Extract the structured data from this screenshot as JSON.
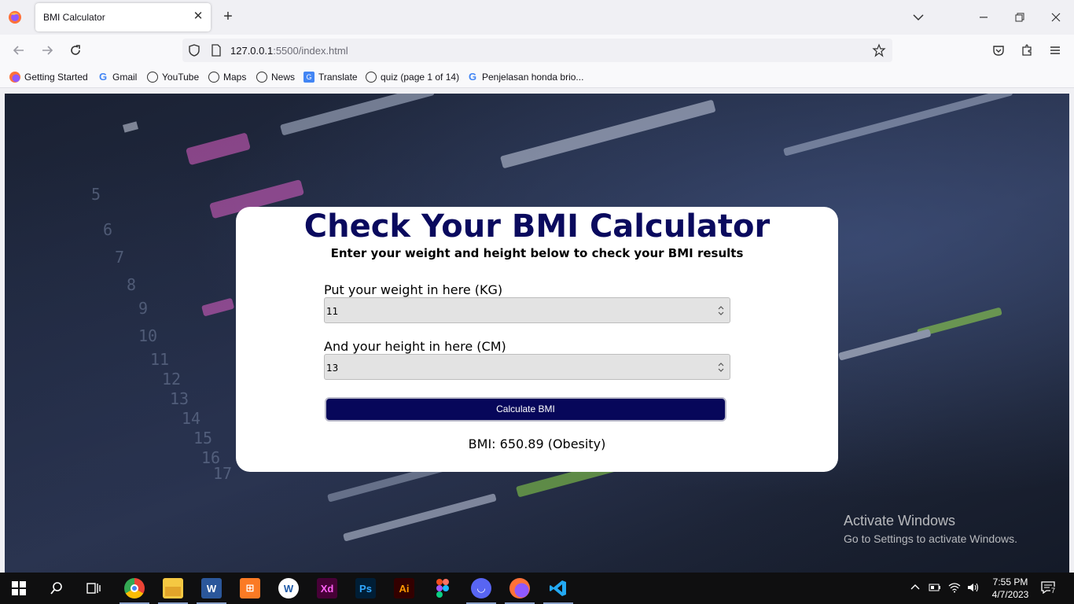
{
  "browser": {
    "tab_title": "BMI Calculator",
    "url_host": "127.0.0.1",
    "url_rest": ":5500/index.html"
  },
  "bookmarks": [
    {
      "label": "Getting Started",
      "icon": "firefox-icon"
    },
    {
      "label": "Gmail",
      "icon": "google-icon"
    },
    {
      "label": "YouTube",
      "icon": "globe-icon"
    },
    {
      "label": "Maps",
      "icon": "globe-icon"
    },
    {
      "label": "News",
      "icon": "globe-icon"
    },
    {
      "label": "Translate",
      "icon": "translate-icon"
    },
    {
      "label": "quiz (page 1 of 14)",
      "icon": "globe-icon"
    },
    {
      "label": "Penjelasan honda brio...",
      "icon": "google-icon"
    }
  ],
  "page": {
    "title": "Check Your BMI Calculator",
    "subtitle": "Enter your weight and height below to check your BMI results",
    "weight_label": "Put your weight in here (KG)",
    "weight_value": "11",
    "height_label": "And your height in here (CM)",
    "height_value": "13",
    "button_label": "Calculate BMI",
    "result": "BMI: 650.89 (Obesity)"
  },
  "watermark": {
    "line1": "Activate Windows",
    "line2": "Go to Settings to activate Windows."
  },
  "taskbar": {
    "time": "7:55 PM",
    "date": "4/7/2023",
    "notification_count": "7",
    "apps": [
      "start",
      "search",
      "task-view",
      "chrome",
      "file-explorer",
      "word",
      "xampp",
      "app-w",
      "xd",
      "photoshop",
      "illustrator",
      "figma",
      "discord",
      "firefox",
      "vscode"
    ],
    "labels": {
      "xd": "Xd",
      "ps": "Ps",
      "ai": "Ai"
    }
  },
  "colors": {
    "title": "#0a0a5e",
    "button": "#07075a",
    "input_bg": "#e3e3e3"
  }
}
